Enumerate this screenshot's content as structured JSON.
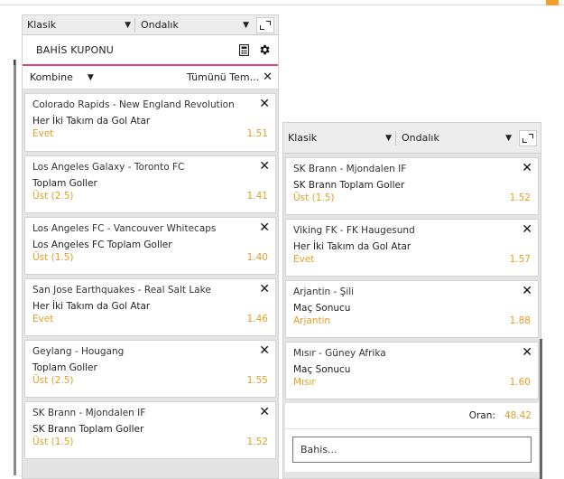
{
  "colors": {
    "accent": "#e0457a",
    "odds": "#e0a028"
  },
  "p1": {
    "type_select": "Klasik",
    "format_select": "Ondalık",
    "title": "BAHİS KUPONU",
    "bet_type": "Kombine",
    "clear_all": "Tümünü Tem...",
    "bets": [
      {
        "match": "Colorado Rapids - New England Revolution",
        "market": "Her İki Takım da Gol Atar",
        "selection": "Evet",
        "odds": "1.51"
      },
      {
        "match": "Los Angeles Galaxy - Toronto FC",
        "market": "Toplam Goller",
        "selection": "Üst (2.5)",
        "odds": "1.41"
      },
      {
        "match": "Los Angeles FC - Vancouver Whitecaps",
        "market": "Los Angeles FC Toplam Goller",
        "selection": "Üst (1.5)",
        "odds": "1.40"
      },
      {
        "match": "San Jose Earthquakes - Real Salt Lake",
        "market": "Her İki Takım da Gol Atar",
        "selection": "Evet",
        "odds": "1.46"
      },
      {
        "match": "Geylang - Hougang",
        "market": "Toplam Goller",
        "selection": "Üst (2.5)",
        "odds": "1.55"
      },
      {
        "match": "SK Brann - Mjondalen IF",
        "market": "SK Brann Toplam Goller",
        "selection": "Üst (1.5)",
        "odds": "1.52"
      }
    ]
  },
  "p2": {
    "type_select": "Klasik",
    "format_select": "Ondalık",
    "bets": [
      {
        "match": "SK Brann - Mjondalen IF",
        "market": "SK Brann Toplam Goller",
        "selection": "Üst (1.5)",
        "odds": "1.52"
      },
      {
        "match": "Viking FK - FK Haugesund",
        "market": "Her İki Takım da Gol Atar",
        "selection": "Evet",
        "odds": "1.57"
      },
      {
        "match": "Arjantin - Şili",
        "market": "Maç Sonucu",
        "selection": "Arjantin",
        "odds": "1.88"
      },
      {
        "match": "Mısır - Güney Afrika",
        "market": "Maç Sonucu",
        "selection": "Mısır",
        "odds": "1.60"
      }
    ],
    "total_label": "Oran:",
    "total_value": "48.42",
    "stake_placeholder": "Bahis..."
  }
}
